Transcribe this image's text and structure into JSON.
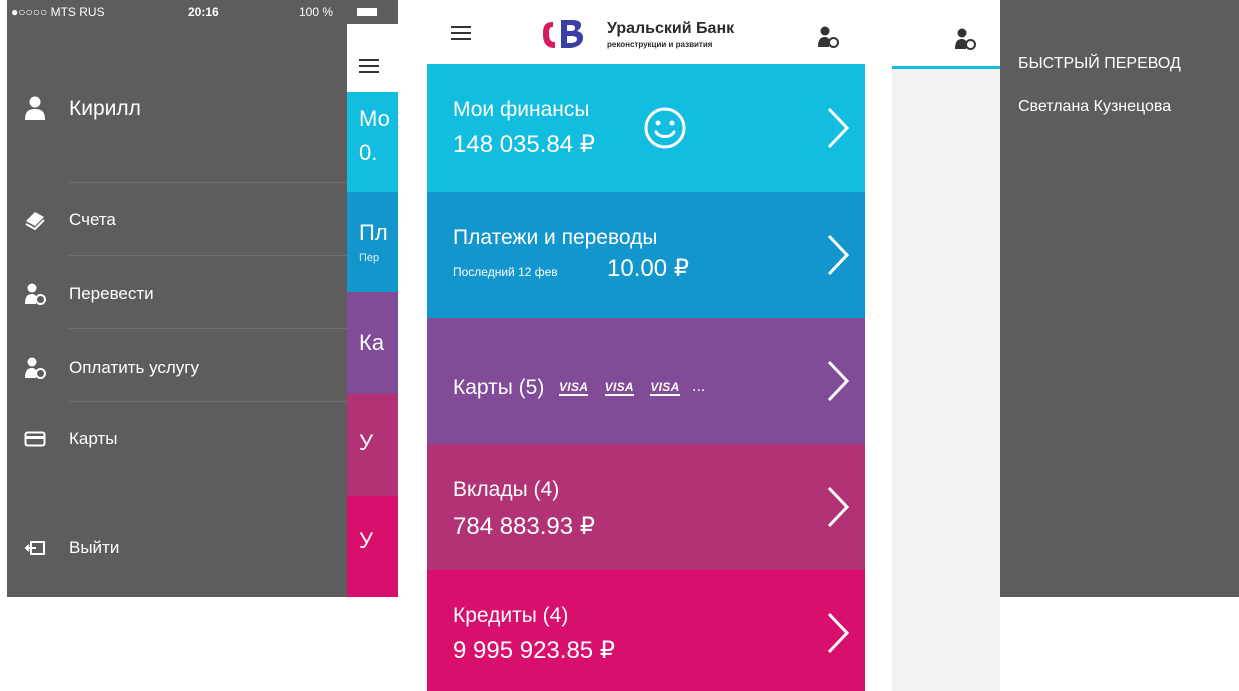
{
  "left_screen": {
    "status_bar": {
      "carrier": "●○○○○ MTS RUS",
      "time": "20:16",
      "battery": "100 %"
    },
    "user_name": "Кирилл",
    "menu": [
      {
        "label": "Счета",
        "icon": "accounts-icon"
      },
      {
        "label": "Перевести",
        "icon": "transfer-user-icon"
      },
      {
        "label": "Оплатить услугу",
        "icon": "pay-service-user-icon"
      },
      {
        "label": "Карты",
        "icon": "card-icon"
      }
    ],
    "logout_label": "Выйти",
    "peek": {
      "band1_line1": "Мо",
      "band1_line2": "0.",
      "band2_line1": "Пл",
      "band2_line2": "Пер",
      "band3_line1": "Ка",
      "band4_line1": "У",
      "band5_line1": "У"
    }
  },
  "center_screen": {
    "bank_name": "Уральский Банк",
    "bank_subtitle": "реконструкции и развития",
    "logo_letters": "UB",
    "sections": [
      {
        "title": "Мои финансы",
        "amount": "148 035.84 ₽",
        "color": "#12bde0",
        "icon": "smiley-icon"
      },
      {
        "title": "Платежи и переводы",
        "last_prefix": "Последний 12 фев",
        "last_amount": "10.00 ₽",
        "color": "#1296cc"
      },
      {
        "title": "Карты (5)",
        "visa": [
          "VISA",
          "VISA",
          "VISA"
        ],
        "more": "...",
        "color": "#814b97"
      },
      {
        "title": "Вклады (4)",
        "amount": "784 883.93 ₽",
        "color": "#b23276"
      },
      {
        "title": "Кредиты (4)",
        "amount": "9 995 923.85 ₽",
        "color": "#d90f6e"
      }
    ]
  },
  "right_screen": {
    "panel_title": "БЫСТРЫЙ ПЕРЕВОД",
    "recipient": "Светлана Кузнецова"
  },
  "colors": {
    "drawer_bg": "#5d5d5d",
    "accent_tab": "#12bde0"
  }
}
